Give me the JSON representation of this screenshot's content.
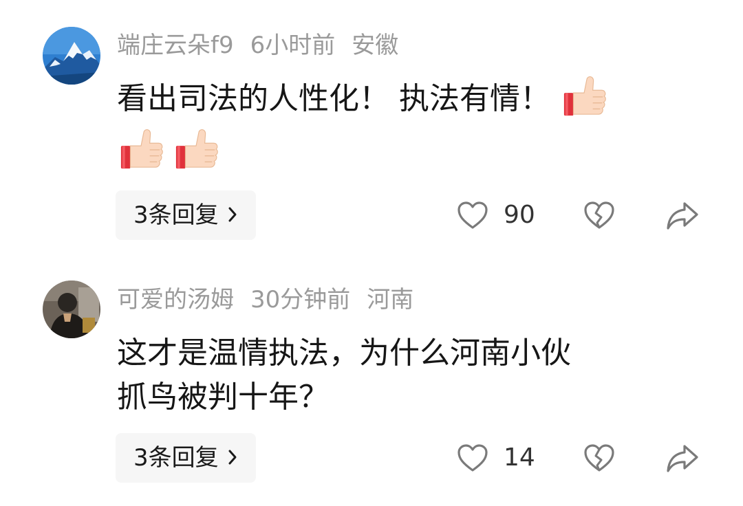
{
  "comments": [
    {
      "username": "端庄云朵f9",
      "time": "6小时前",
      "location": "安徽",
      "text": "看出司法的人性化！ 执法有情！",
      "emoji": [
        "thumbs-up",
        "thumbs-up",
        "thumbs-up"
      ],
      "replies_label": "3条回复",
      "likes": "90",
      "avatar": "snowy-mountain-photo"
    },
    {
      "username": "可爱的汤姆",
      "time": "30分钟前",
      "location": "河南",
      "text_line1": "这才是温情执法，为什么河南小伙",
      "text_line2": "抓鸟被判十年？",
      "replies_label": "3条回复",
      "likes": "14",
      "avatar": "person-photo"
    }
  ],
  "icons": {
    "like": "heart-outline-icon",
    "dislike": "broken-heart-icon",
    "share": "share-arrow-icon",
    "chevron": "chevron-right-icon"
  },
  "colors": {
    "meta": "#9a9a9a",
    "icon": "#7a7a7a",
    "reply_bg": "#f6f6f6"
  }
}
